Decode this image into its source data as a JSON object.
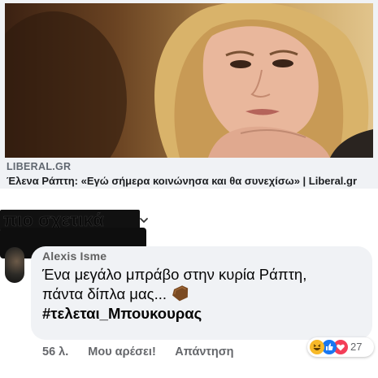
{
  "link_preview": {
    "domain": "LIBERAL.GR",
    "headline": "Έλενα Ράπτη: «Εγώ σήμερα κοινώνησα και θα συνεχίσω» | Liberal.gr"
  },
  "comments_header": {
    "sort_label": "πιο σχετικά"
  },
  "comment": {
    "author": "Alexis Isme",
    "line1": "Ένα μεγάλο μπράβο στην κυρία Ράπτη,",
    "line2": "πάντα δίπλα μας...",
    "hashtag": "#τελεται_Μπουκουρας",
    "time": "56 λ.",
    "like_label": "Μου αρέσει!",
    "reply_label": "Απάντηση",
    "reaction_count": "27",
    "reactions": [
      "haha-icon",
      "like-icon",
      "love-icon"
    ]
  },
  "colors": {
    "bubble_bg": "#f0f2f5",
    "meta_text": "#65676b",
    "like_blue": "#1877f2",
    "love_red": "#f33e58",
    "haha_yellow": "#f7b928"
  }
}
